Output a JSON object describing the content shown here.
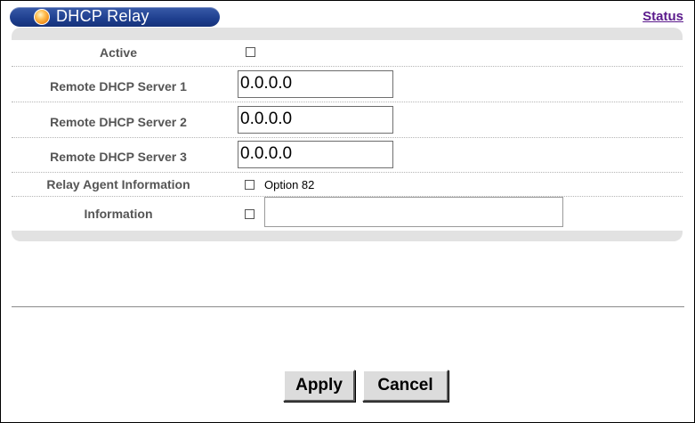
{
  "header": {
    "title": "DHCP Relay",
    "status_link": "Status"
  },
  "form": {
    "active": {
      "label": "Active",
      "checked": false
    },
    "server1": {
      "label": "Remote DHCP Server 1",
      "value": "0.0.0.0"
    },
    "server2": {
      "label": "Remote DHCP Server 2",
      "value": "0.0.0.0"
    },
    "server3": {
      "label": "Remote DHCP Server 3",
      "value": "0.0.0.0"
    },
    "relay_agent": {
      "label": "Relay Agent Information",
      "option_label": "Option 82",
      "checked": false
    },
    "information": {
      "label": "Information",
      "checked": false,
      "value": ""
    }
  },
  "buttons": {
    "apply": "Apply",
    "cancel": "Cancel"
  }
}
